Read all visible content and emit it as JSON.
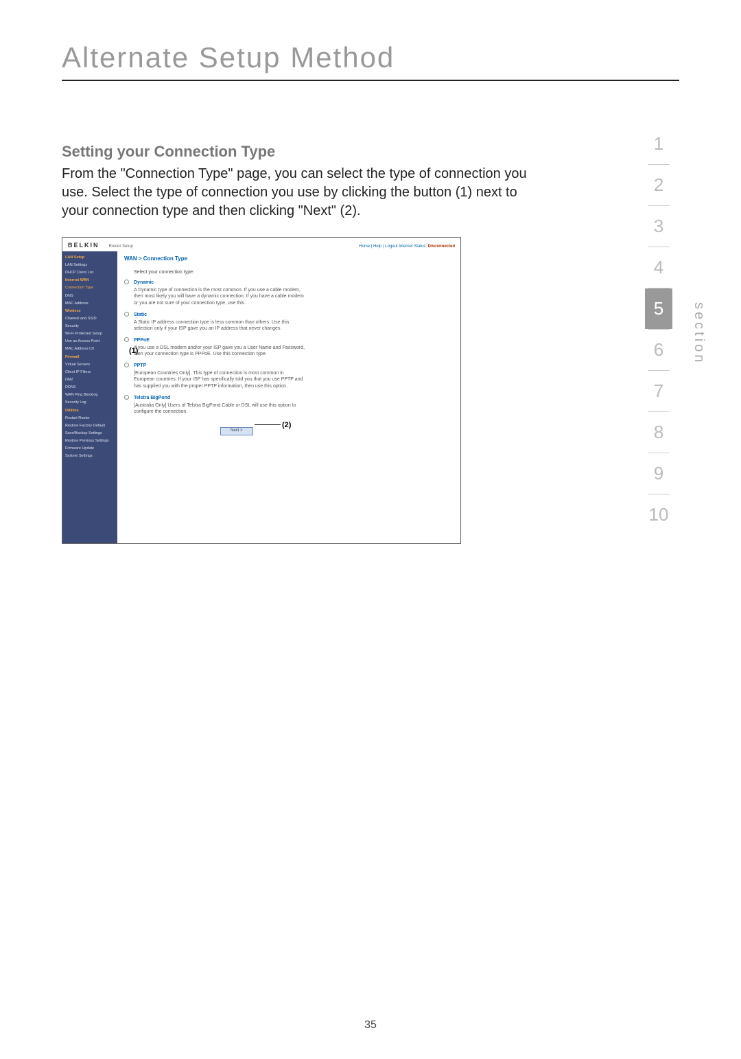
{
  "page_number": "35",
  "title": "Alternate Setup Method",
  "section_label": "section",
  "subhead": "Setting your Connection Type",
  "body_text": "From the \"Connection Type\" page, you can select the type of connection you use. Select the type of connection you use by clicking the button (1) next to your connection type and then clicking \"Next\" (2).",
  "section_numbers": [
    "1",
    "2",
    "3",
    "4",
    "5",
    "6",
    "7",
    "8",
    "9",
    "10"
  ],
  "active_section": "5",
  "callouts": {
    "one": "(1)",
    "two": "(2)"
  },
  "screenshot": {
    "brand": "BELKIN",
    "brand_sub": "Router Setup",
    "header_links": "Home | Help | Logout   Internet Status:",
    "status": "Disconnected",
    "breadcrumb": "WAN > Connection Type",
    "instruction": "Select your connection type:",
    "options": [
      {
        "label": "Dynamic",
        "desc": "A Dynamic type of connection is the most common. If you use a cable modem, then most likely you will have a dynamic connection. If you have a cable modem or you are not sure of your connection type, use this."
      },
      {
        "label": "Static",
        "desc": "A Static IP address connection type is less common than others. Use this selection only if your ISP gave you an IP address that never changes."
      },
      {
        "label": "PPPoE",
        "desc": "If you use a DSL modem and/or your ISP gave you a User Name and Password, then your connection type is PPPoE. Use this connection type."
      },
      {
        "label": "PPTP",
        "desc": "[European Countries Only]. This type of connection is most common in European countries. If your ISP has specifically told you that you use PPTP and has supplied you with the proper PPTP information, then use this option."
      },
      {
        "label": "Telstra BigPond",
        "desc": "[Australia Only] Users of Telstra BigPond Cable or DSL will use this option to configure the connection."
      }
    ],
    "next_button": "Next >",
    "sidebar": {
      "groups": [
        {
          "cat": "LAN Setup",
          "items": [
            "LAN Settings",
            "DHCP Client List"
          ]
        },
        {
          "cat": "Internet WAN",
          "items": [
            "Connection Type",
            "DNS",
            "MAC Address"
          ]
        },
        {
          "cat": "Wireless",
          "items": [
            "Channel and SSID",
            "Security",
            "Wi-Fi Protected Setup",
            "Use as Access Point",
            "MAC Address Ctl"
          ]
        },
        {
          "cat": "Firewall",
          "items": [
            "Virtual Servers",
            "Client IP Filters",
            "DMZ",
            "DDNS",
            "WAN Ping Blocking",
            "Security Log"
          ]
        },
        {
          "cat": "Utilities",
          "items": [
            "Restart Router",
            "Restore Factory Default",
            "Save/Backup Settings",
            "Restore Previous Settings",
            "Firmware Update",
            "System Settings"
          ]
        }
      ],
      "active_item": "Connection Type"
    }
  }
}
